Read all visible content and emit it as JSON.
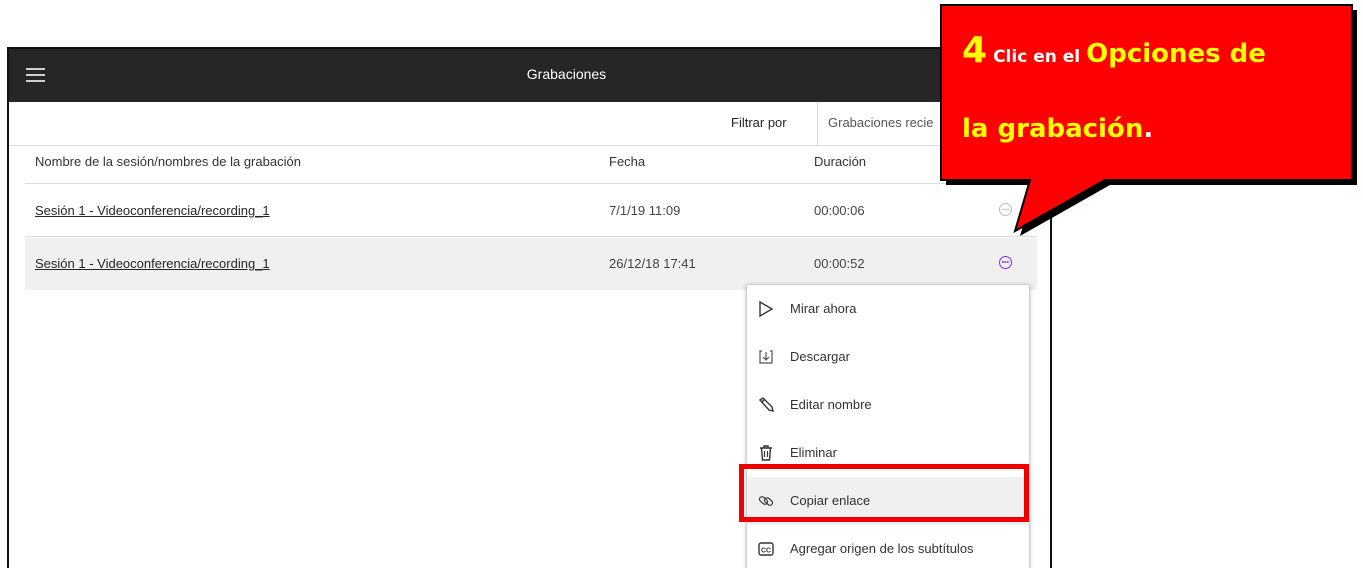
{
  "header": {
    "menu_icon": "hamburger-icon",
    "title": "Grabaciones"
  },
  "filter": {
    "label": "Filtrar por",
    "selected": "Grabaciones recie"
  },
  "table": {
    "columns": [
      "Nombre de la sesión/nombres de la grabación",
      "Fecha",
      "Duración"
    ],
    "rows": [
      {
        "name": "Sesión 1 - Videoconferencia/recording_1",
        "date": "7/1/19 11:09",
        "duration": "00:00:06"
      },
      {
        "name": "Sesión 1 - Videoconferencia/recording_1",
        "date": "26/12/18 17:41",
        "duration": "00:00:52"
      }
    ],
    "options_icon": "more-options-icon"
  },
  "menu": {
    "items": [
      {
        "label": "Mirar ahora",
        "icon": "play-icon"
      },
      {
        "label": "Descargar",
        "icon": "download-icon"
      },
      {
        "label": "Editar nombre",
        "icon": "pencil-icon"
      },
      {
        "label": "Eliminar",
        "icon": "trash-icon"
      },
      {
        "label": "Copiar enlace",
        "icon": "link-icon"
      },
      {
        "label": "Agregar origen de los subtítulos",
        "icon": "cc-icon"
      }
    ]
  },
  "callout": {
    "number": "4",
    "text_a": "Clic en el",
    "text_b": "Opciones de",
    "text_c": "la grabación",
    "text_end": ".",
    "colors": {
      "fill": "#ff0000",
      "text": "#ffff00",
      "border": "#000000"
    }
  },
  "colors": {
    "topbar": "#262626",
    "accent": "#8a2be2",
    "highlight": "#ee0000"
  }
}
